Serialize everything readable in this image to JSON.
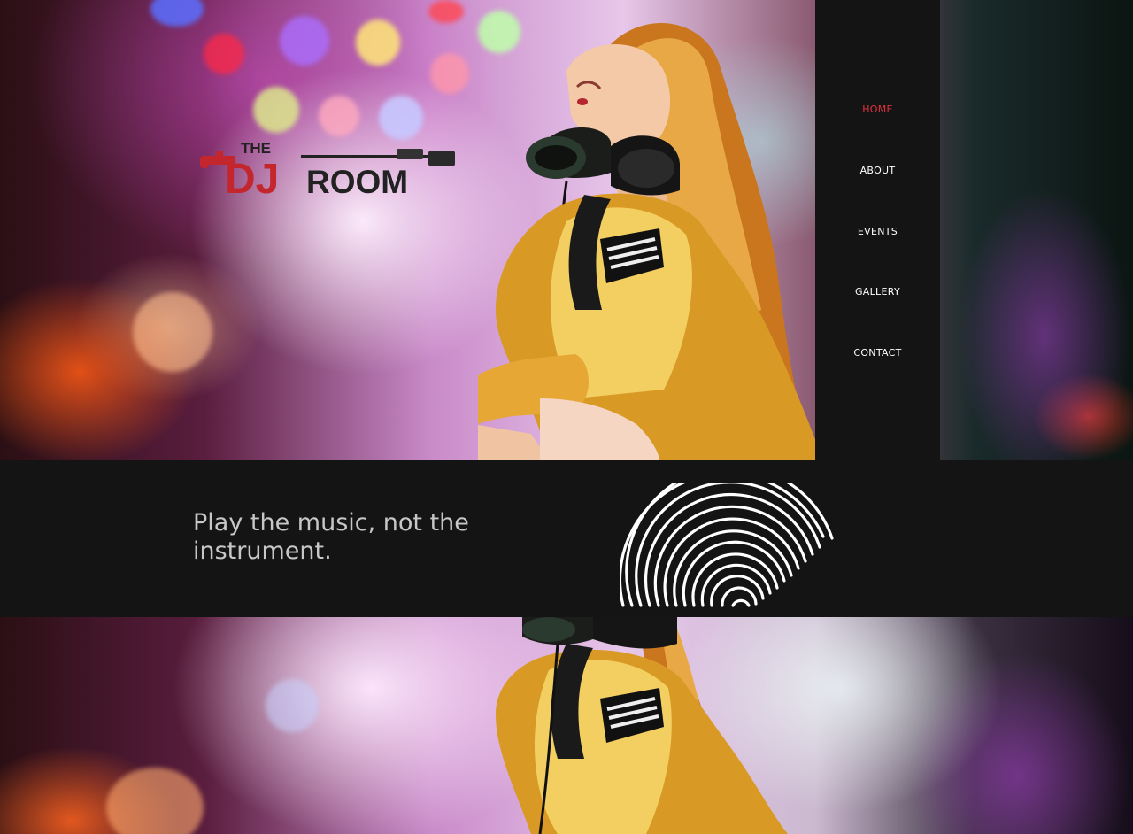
{
  "brand": {
    "logo_the": "THE",
    "logo_dj": "DJ",
    "logo_room": "ROOM"
  },
  "nav": {
    "items": [
      {
        "label": "HOME",
        "active": true
      },
      {
        "label": "ABOUT",
        "active": false
      },
      {
        "label": "EVENTS",
        "active": false
      },
      {
        "label": "GALLERY",
        "active": false
      },
      {
        "label": "CONTACT",
        "active": false
      }
    ]
  },
  "band": {
    "quote_line1": "Play the music, not the",
    "quote_line2": "instrument."
  },
  "colors": {
    "background": "#141414",
    "accent": "#e0323c",
    "nav_text": "#ffffff",
    "quote_text": "#c7c7c7"
  },
  "icons": [
    "dj-room-logo-icon",
    "vinyl-record-icon",
    "headphones-icon"
  ]
}
